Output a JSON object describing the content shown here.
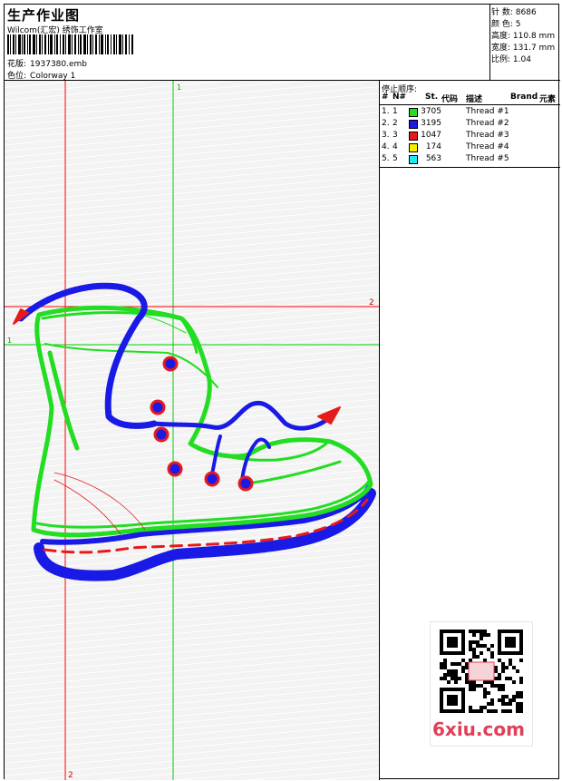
{
  "header": {
    "title": "生产作业图",
    "company": "Wilcom(汇宏) 绣饰工作室",
    "design_label": "花版:",
    "design_value": "1937380.emb",
    "colorway_label": "色位:",
    "colorway_value": "Colorway 1"
  },
  "stats": {
    "stitches_label": "针 数:",
    "stitches_value": "8686",
    "colors_label": "颜 色:",
    "colors_value": "5",
    "height_label": "高度:",
    "height_value": "110.8 mm",
    "width_label": "宽度:",
    "width_value": "131.7 mm",
    "scale_label": "比例:",
    "scale_value": "1.04"
  },
  "canvas": {
    "guide_v_green_label": "1",
    "guide_h_green_label": "1",
    "guide_v_red_label": "2",
    "guide_h_red_label": "2"
  },
  "stop_sequence": {
    "title": "停止顺序:",
    "headers": {
      "num": "#",
      "n": "N#",
      "st": "St.",
      "code": "代码",
      "desc": "描述",
      "brand": "Brand",
      "element": "元素"
    },
    "rows": [
      {
        "num": "1.",
        "n": "1",
        "color": "#22dd22",
        "st": "3705",
        "desc": "Thread #1"
      },
      {
        "num": "2.",
        "n": "2",
        "color": "#1a1ae6",
        "st": "3195",
        "desc": "Thread #2"
      },
      {
        "num": "3.",
        "n": "3",
        "color": "#e61a1a",
        "st": "1047",
        "desc": "Thread #3"
      },
      {
        "num": "4.",
        "n": "4",
        "color": "#f5f000",
        "st": "174",
        "desc": "Thread #4"
      },
      {
        "num": "5.",
        "n": "5",
        "color": "#22e6f0",
        "st": "563",
        "desc": "Thread #5"
      }
    ]
  },
  "watermark": {
    "site": "6xiu.com"
  },
  "colors": {
    "green": "#22dd22",
    "blue": "#1a1ae6",
    "red": "#e61a1a",
    "guide_red": "#ff0000",
    "guide_green": "#00cc00"
  }
}
